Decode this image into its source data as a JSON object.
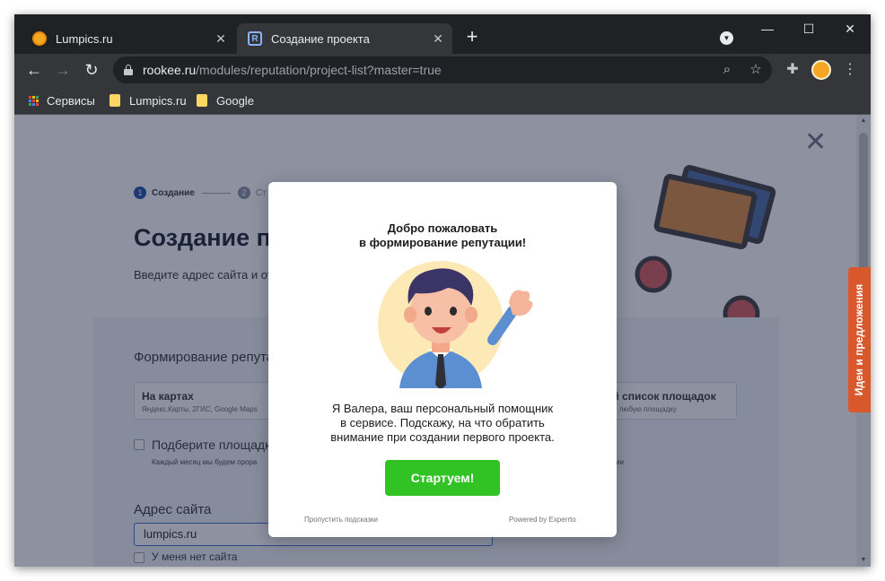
{
  "browser": {
    "tabs": [
      {
        "title": "Lumpics.ru",
        "active": false
      },
      {
        "title": "Создание проекта",
        "active": true
      }
    ],
    "url": {
      "host": "rookee.ru",
      "path": "/modules/reputation/project-list?master=true"
    },
    "bookmarks": [
      {
        "label": "Сервисы",
        "icon": "apps-grid-icon"
      },
      {
        "label": "Lumpics.ru",
        "icon": "folder-icon"
      },
      {
        "label": "Google",
        "icon": "folder-icon"
      }
    ],
    "window_controls": {
      "minimize": "—",
      "maximize": "☐",
      "close": "✕"
    },
    "colors": {
      "frame": "#202124",
      "toolbar": "#35363a"
    }
  },
  "page": {
    "steps": [
      {
        "num": "1",
        "label": "Создание"
      },
      {
        "num": "2",
        "label": "Ст"
      }
    ],
    "heading": "Создание п",
    "subtitle": "Введите адрес сайта и отм",
    "section_label": "Формирование репутац",
    "option_cards": [
      {
        "title": "На картах",
        "subtitle": "Яндекс.Карты, 2ГИС, Google Maps"
      },
      {
        "title": "ой список площадок",
        "subtitle": "ите любую площадку"
      }
    ],
    "checkbox_pick": {
      "label": "Подберите площадк",
      "note": "Каждый месяц мы будем прора",
      "note_right": "ии"
    },
    "site_field": {
      "label": "Адрес сайта",
      "value": "lumpics.ru"
    },
    "no_site": {
      "label": "У меня нет сайта"
    },
    "ideas_tab": "Идеи и предложения",
    "close_glyph": "✕"
  },
  "modal": {
    "title_line1": "Добро пожаловать",
    "title_line2": "в формирование репутации!",
    "text_line1": "Я Валера, ваш персональный помощник",
    "text_line2": "в сервисе. Подскажу, на что обратить",
    "text_line3": "внимание при создании первого проекта.",
    "start_button": "Стартуем!",
    "skip_link": "Пропустить подсказки",
    "powered_by": "Powered by Experrto",
    "colors": {
      "button": "#31c223"
    }
  }
}
